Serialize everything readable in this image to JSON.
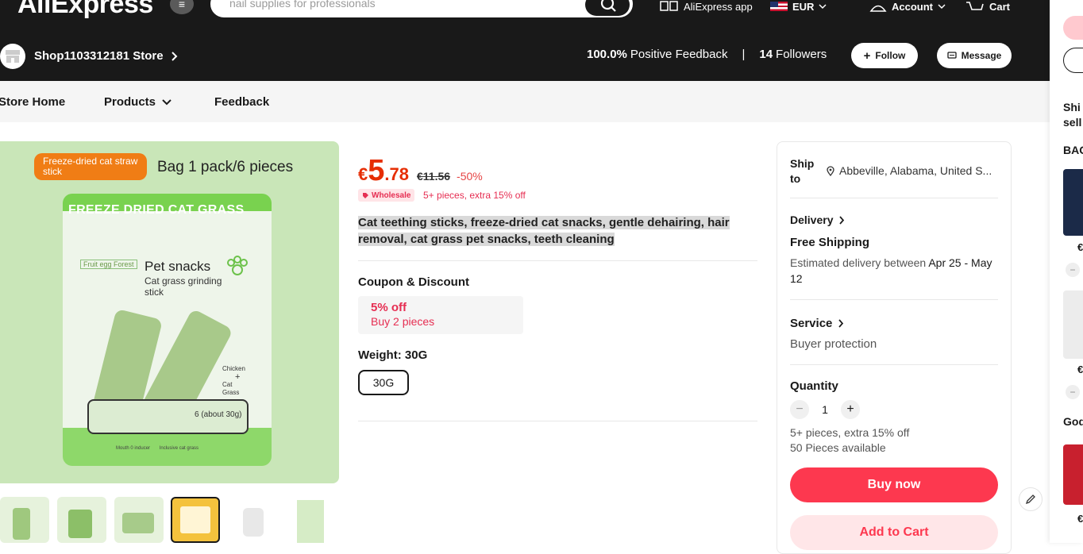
{
  "header": {
    "logo": "AliExpress",
    "search_placeholder": "nail supplies for professionals",
    "app_label": "AliExpress app",
    "currency": "EUR",
    "account_label": "Account",
    "cart_label": "Cart"
  },
  "store": {
    "name": "Shop1103312181 Store",
    "feedback_value": "100.0%",
    "feedback_label": "Positive Feedback",
    "separator": "|",
    "followers_value": "14",
    "followers_label": "Followers",
    "follow_label": "Follow",
    "message_label": "Message"
  },
  "store_nav": {
    "home": "Store Home",
    "products": "Products",
    "feedback": "Feedback"
  },
  "main_image": {
    "badge": "Freeze-dried cat straw stick",
    "label": "Bag 1 pack/6 pieces",
    "bag_title": "FREEZE DRIED CAT GRASS",
    "bag_brand": "Fruit egg Forest",
    "bag_snacks": "Pet snacks",
    "bag_desc": "Cat grass grinding stick",
    "bag_flavor_1": "Chicken",
    "bag_flavor_plus": "+",
    "bag_flavor_2": "Cat",
    "bag_flavor_3": "Grass",
    "bag_count": "6 (about 30g)",
    "bag_foot_1": "Mouth 0 inducer",
    "bag_foot_2": "Inclusive cat grass"
  },
  "product": {
    "currency_symbol": "€",
    "price_int": "5",
    "price_dec": ".78",
    "price_old": "€11.56",
    "discount": "-50%",
    "wholesale_badge": "Wholesale",
    "wholesale_note": "5+ pieces, extra 15% off",
    "title": "Cat teething sticks, freeze-dried cat snacks, gentle dehairing, hair removal, cat grass pet snacks, teeth cleaning",
    "coupon_section": "Coupon & Discount",
    "coupon_title": "5% off",
    "coupon_sub": "Buy 2 pieces",
    "weight_label": "Weight: 30G",
    "weight_option": "30G"
  },
  "side": {
    "ship_to_label_1": "Ship",
    "ship_to_label_2": "to",
    "ship_location": "Abbeville, Alabama, United S...",
    "delivery_label": "Delivery",
    "free_shipping": "Free Shipping",
    "estimated_prefix": "Estimated delivery between",
    "estimated_dates_1": "Apr 25 -",
    "estimated_dates_2": "May 12",
    "service_label": "Service",
    "service_value": "Buyer protection",
    "quantity_label": "Quantity",
    "quantity_value": "1",
    "qty_minus": "−",
    "qty_plus": "+",
    "qty_note": "5+ pieces, extra 15% off",
    "available": "50 Pieces available",
    "buy_now": "Buy now",
    "add_to_cart": "Add to Cart"
  },
  "right_panel": {
    "ship_line_1": "Shi",
    "ship_line_2": "sell",
    "bag_label": "BAG",
    "price_1": "€",
    "price_2": "€",
    "goods_label": "God",
    "price_3": "€",
    "minus": "−"
  },
  "colors": {
    "accent": "#fd384f",
    "price": "#e62e04",
    "header_bg": "#191919"
  }
}
